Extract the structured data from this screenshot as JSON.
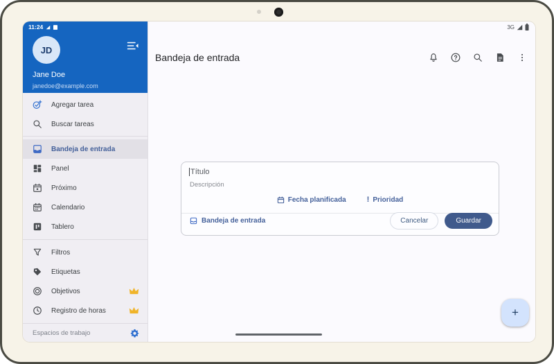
{
  "status_bar": {
    "time": "11:24",
    "network": "3G"
  },
  "sidebar": {
    "avatar_initials": "JD",
    "user_name": "Jane Doe",
    "user_email": "janedoe@example.com",
    "items_top": [
      {
        "label": "Agregar tarea",
        "icon": "add-task-icon"
      },
      {
        "label": "Buscar tareas",
        "icon": "search-icon"
      }
    ],
    "items_nav": [
      {
        "label": "Bandeja de entrada",
        "icon": "inbox-icon",
        "selected": true
      },
      {
        "label": "Panel",
        "icon": "dashboard-icon"
      },
      {
        "label": "Próximo",
        "icon": "upcoming-icon"
      },
      {
        "label": "Calendario",
        "icon": "calendar-icon"
      },
      {
        "label": "Tablero",
        "icon": "board-icon"
      }
    ],
    "items_tools": [
      {
        "label": "Filtros",
        "icon": "filter-icon"
      },
      {
        "label": "Etiquetas",
        "icon": "label-icon"
      },
      {
        "label": "Objetivos",
        "icon": "goals-icon",
        "premium": true
      },
      {
        "label": "Registro de horas",
        "icon": "time-log-icon",
        "premium": true
      }
    ],
    "footer_label": "Espacios de trabajo"
  },
  "main": {
    "title": "Bandeja de entrada",
    "form": {
      "title_placeholder": "Título",
      "description_placeholder": "Descripción",
      "date_chip": "Fecha planificada",
      "priority_chip": "Prioridad",
      "priority_icon_glyph": "!",
      "project_chip": "Bandeja de entrada",
      "cancel_button": "Cancelar",
      "save_button": "Guardar"
    },
    "fab_glyph": "+"
  },
  "colors": {
    "header_blue": "#1565C0",
    "slate_blue": "#44609A",
    "save_button_bg": "#405A8C",
    "fab_bg": "#D3E3FD",
    "crown_gold": "#F0B429",
    "selected_item_bg": "#E2E0E6"
  }
}
